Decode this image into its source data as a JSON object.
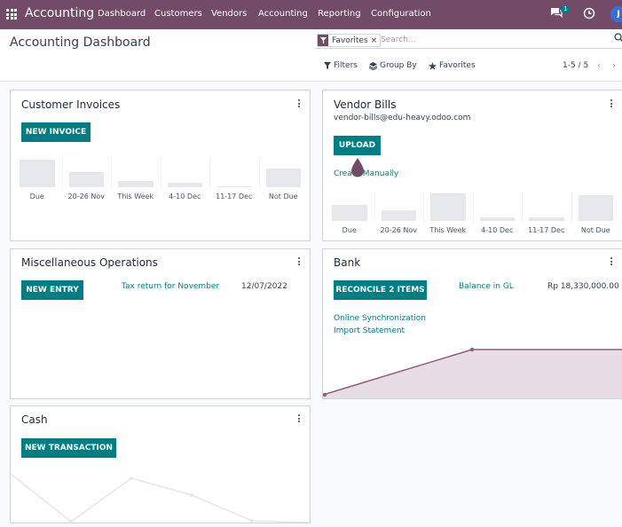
{
  "navbar": {
    "brand": "Accounting",
    "menu": [
      "Dashboard",
      "Customers",
      "Vendors",
      "Accounting",
      "Reporting",
      "Configuration"
    ],
    "chat_badge": "1",
    "avatar": "J",
    "icons": [
      "apps-grid-icon",
      "chat-icon",
      "clock-icon"
    ],
    "color": "#714b67"
  },
  "control_panel": {
    "title": "Accounting Dashboard",
    "facet_label": "Favorites",
    "facet_close": "×",
    "search_placeholder": "Search...",
    "filters_label": "Filters",
    "group_by_label": "Group By",
    "favorites_label": "Favorites",
    "pager": "1-5 / 5",
    "pager_prev": "‹",
    "pager_next": "›"
  },
  "cards": {
    "customer_invoices": {
      "title": "Customer Invoices",
      "button": "NEW INVOICE",
      "chart_labels": [
        "Due",
        "20-26 Nov",
        "This Week",
        "4-10 Dec",
        "11-17 Dec",
        "Not Due"
      ],
      "chart_values": [
        31,
        17,
        7,
        5,
        1,
        21
      ]
    },
    "vendor_bills": {
      "title": "Vendor Bills",
      "email": "vendor-bills@edu-heavy.odoo.com",
      "button": "UPLOAD",
      "link": "Create Manually",
      "chart_labels": [
        "Due",
        "20-26 Nov",
        "This Week",
        "4-10 Dec",
        "11-17 Dec",
        "Not Due"
      ],
      "chart_values": [
        18,
        12,
        31,
        4,
        4,
        29
      ]
    },
    "misc": {
      "title": "Miscellaneous Operations",
      "button": "NEW ENTRY",
      "entry_link": "Tax return for November",
      "entry_date": "12/07/2022"
    },
    "bank": {
      "title": "Bank",
      "button": "RECONCILE 2 ITEMS",
      "balance_label": "Balance in GL",
      "balance_value": "Rp 18,330,000.00",
      "online_sync": "Online Synchronization",
      "import_statement": "Import Statement"
    },
    "cash": {
      "title": "Cash",
      "button": "NEW TRANSACTION"
    }
  },
  "theme": {
    "accent": "#017e84",
    "brand": "#714b67",
    "bank_fill": "#e8dde4",
    "bank_line": "#8b5e7e"
  }
}
